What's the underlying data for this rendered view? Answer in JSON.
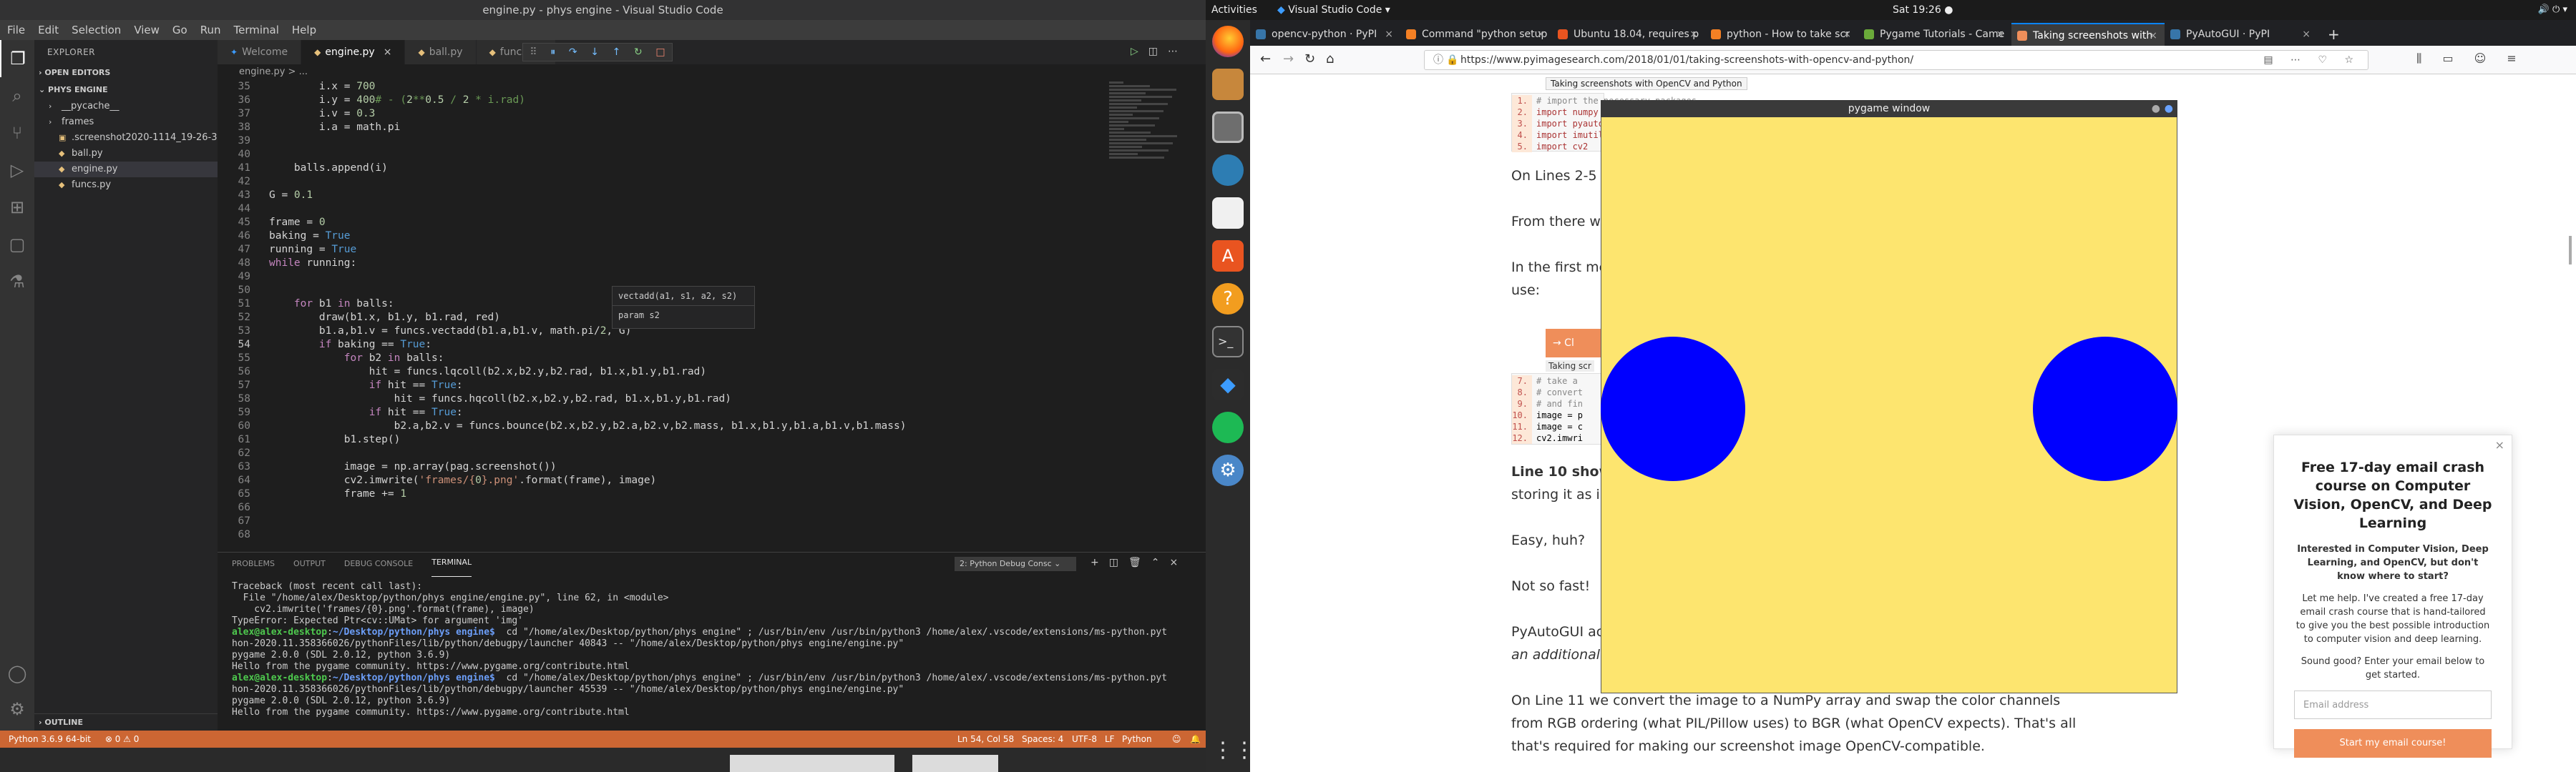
{
  "vscode": {
    "title": "engine.py - phys engine - Visual Studio Code",
    "menu": [
      "File",
      "Edit",
      "Selection",
      "View",
      "Go",
      "Run",
      "Terminal",
      "Help"
    ],
    "explorer": {
      "header": "EXPLORER",
      "open_editors": "OPEN EDITORS",
      "project": "PHYS ENGINE",
      "items": [
        "__pycache__",
        "frames",
        ".screenshot2020-1114_19-26-34-66...",
        "ball.py",
        "engine.py",
        "funcs.py"
      ],
      "outline": "OUTLINE"
    },
    "tabs": [
      "Welcome",
      "engine.py",
      "ball.py",
      "funcs.py"
    ],
    "breadcrumb": "engine.py > ...",
    "code": [
      {
        "n": "35",
        "t": "        i.x = 700"
      },
      {
        "n": "36",
        "t": "        i.y = 400# - (2**0.5 / 2 * i.rad)"
      },
      {
        "n": "37",
        "t": "        i.v = 0.3"
      },
      {
        "n": "38",
        "t": "        i.a = math.pi"
      },
      {
        "n": "39",
        "t": ""
      },
      {
        "n": "40",
        "t": ""
      },
      {
        "n": "41",
        "t": "    balls.append(i)"
      },
      {
        "n": "42",
        "t": ""
      },
      {
        "n": "43",
        "t": "G = 0.1"
      },
      {
        "n": "44",
        "t": ""
      },
      {
        "n": "45",
        "t": "frame = 0"
      },
      {
        "n": "46",
        "t": "baking = True"
      },
      {
        "n": "47",
        "t": "running = True"
      },
      {
        "n": "48",
        "t": "while running:"
      },
      {
        "n": "49",
        "t": ""
      },
      {
        "n": "50",
        "t": ""
      },
      {
        "n": "51",
        "t": "    for b1 in balls:"
      },
      {
        "n": "52",
        "t": "        draw(b1.x, b1.y, b1.rad, red)"
      },
      {
        "n": "53",
        "t": "        b1.a,b1.v = funcs.vectadd(b1.a,b1.v, math.pi/2, G)"
      },
      {
        "n": "54",
        "t": "        if baking == True:"
      },
      {
        "n": "55",
        "t": "            for b2 in balls:"
      },
      {
        "n": "56",
        "t": "                hit = funcs.lqcoll(b2.x,b2.y,b2.rad, b1.x,b1.y,b1.rad)"
      },
      {
        "n": "57",
        "t": "                if hit == True:"
      },
      {
        "n": "58",
        "t": "                    hit = funcs.hqcoll(b2.x,b2.y,b2.rad, b1.x,b1.y,b1.rad)"
      },
      {
        "n": "59",
        "t": "                if hit == True:"
      },
      {
        "n": "60",
        "t": "                    b2.a,b2.v = funcs.bounce(b2.x,b2.y,b2.a,b2.v,b2.mass, b1.x,b1.y,b1.a,b1.v,b1.mass)"
      },
      {
        "n": "61",
        "t": "            b1.step()"
      },
      {
        "n": "62",
        "t": ""
      },
      {
        "n": "63",
        "t": "            image = np.array(pag.screenshot())"
      },
      {
        "n": "64",
        "t": "            cv2.imwrite('frames/{0}.png'.format(frame), image)"
      },
      {
        "n": "65",
        "t": "            frame += 1"
      },
      {
        "n": "66",
        "t": ""
      },
      {
        "n": "67",
        "t": ""
      },
      {
        "n": "68",
        "t": ""
      }
    ],
    "hint": {
      "signature": "vectadd(a1, s1, a2, s2)",
      "param": "param s2"
    },
    "panel": {
      "tabs": [
        "PROBLEMS",
        "OUTPUT",
        "DEBUG CONSOLE",
        "TERMINAL"
      ],
      "terminal_select": "2: Python Debug Consc",
      "lines": [
        "Traceback (most recent call last):",
        "  File \"/home/alex/Desktop/python/phys engine/engine.py\", line 62, in <module>",
        "    cv2.imwrite('frames/{0}.png'.format(frame), image)",
        "TypeError: Expected Ptr<cv::UMat> for argument 'img'",
        "alex@alex-desktop:~/Desktop/python/phys engine$  cd \"/home/alex/Desktop/python/phys engine\" ; /usr/bin/env /usr/bin/python3 /home/alex/.vscode/extensions/ms-python.pyt",
        "hon-2020.11.358366026/pythonFiles/lib/python/debugpy/launcher 40843 -- \"/home/alex/Desktop/python/phys engine/engine.py\"",
        "pygame 2.0.0 (SDL 2.0.12, python 3.6.9)",
        "Hello from the pygame community. https://www.pygame.org/contribute.html",
        "alex@alex-desktop:~/Desktop/python/phys engine$  cd \"/home/alex/Desktop/python/phys engine\" ; /usr/bin/env /usr/bin/python3 /home/alex/.vscode/extensions/ms-python.pyt",
        "hon-2020.11.358366026/pythonFiles/lib/python/debugpy/launcher 45539 -- \"/home/alex/Desktop/python/phys engine/engine.py\"",
        "pygame 2.0.0 (SDL 2.0.12, python 3.6.9)",
        "Hello from the pygame community. https://www.pygame.org/contribute.html"
      ]
    },
    "status": {
      "python": "Python 3.6.9 64-bit",
      "problems": "⊗ 0 ⚠ 0",
      "position": "Ln 54, Col 58",
      "spaces": "Spaces: 4",
      "encoding": "UTF-8",
      "eol": "LF",
      "language": "Python"
    }
  },
  "ubuntu": {
    "activities": "Activities",
    "app": "Visual Studio Code ▾",
    "clock": "Sat 19:26 ●"
  },
  "browser": {
    "tabs": [
      "opencv-python · PyPI",
      "Command \"python setup",
      "Ubuntu 18.04, requires p",
      "python - How to take scr",
      "Pygame Tutorials - Came",
      "Taking screenshots with",
      "PyAutoGUI · PyPI"
    ],
    "url": "https://www.pyimagesearch.com/2018/01/01/taking-screenshots-with-opencv-and-python/",
    "tooltip": "Taking screenshots with OpenCV and Python",
    "article": {
      "code1": [
        "# import the necessary packages",
        "import numpy as np",
        "import pyautogui",
        "import imutils",
        "import cv2"
      ],
      "code1_nums": [
        "1.",
        "2.",
        "3.",
        "4.",
        "5."
      ],
      "p1": "On Lines 2-5 w",
      "p2": "From there we",
      "p3a": "In the first meth",
      "p3b": "use:",
      "btn": "→ Cl",
      "code2_title": "Taking scr",
      "code2": [
        "# take a",
        "# convert",
        "# and fin",
        "image = p",
        "image = c",
        "cv2.imwri"
      ],
      "code2_nums": [
        "7.",
        "8.",
        "9.",
        "10.",
        "11.",
        "12."
      ],
      "p4a": "Line 10 shows",
      "p4b": "storing it as  im",
      "p5": "Easy, huh?",
      "p6": "Not so fast!",
      "p7a": "PyAutoGUI act",
      "p7b": "an additional s",
      "p8a": "On Line 11 we convert the image to a NumPy array and swap the color channels",
      "p8b": "from RGB ordering (what PIL/Pillow uses) to BGR (what OpenCV expects). That's all",
      "p8c": "that's required for making our screenshot image OpenCV-compatible."
    },
    "popup": {
      "title": "Free 17-day email crash course on Computer Vision, OpenCV, and Deep Learning",
      "p1": "Interested in Computer Vision, Deep Learning, and OpenCV, but don't know where to start?",
      "p2": "Let me help. I've created a free 17-day email crash course that is hand-tailored to give you the best possible introduction to computer vision and deep learning.",
      "p3": "Sound good? Enter your email below to get started.",
      "placeholder": "Email address",
      "cta": "Start my email course!"
    }
  },
  "pygame": {
    "title": "pygame window",
    "bg_color": "#fde56f",
    "ball_color": "#0000ff"
  }
}
